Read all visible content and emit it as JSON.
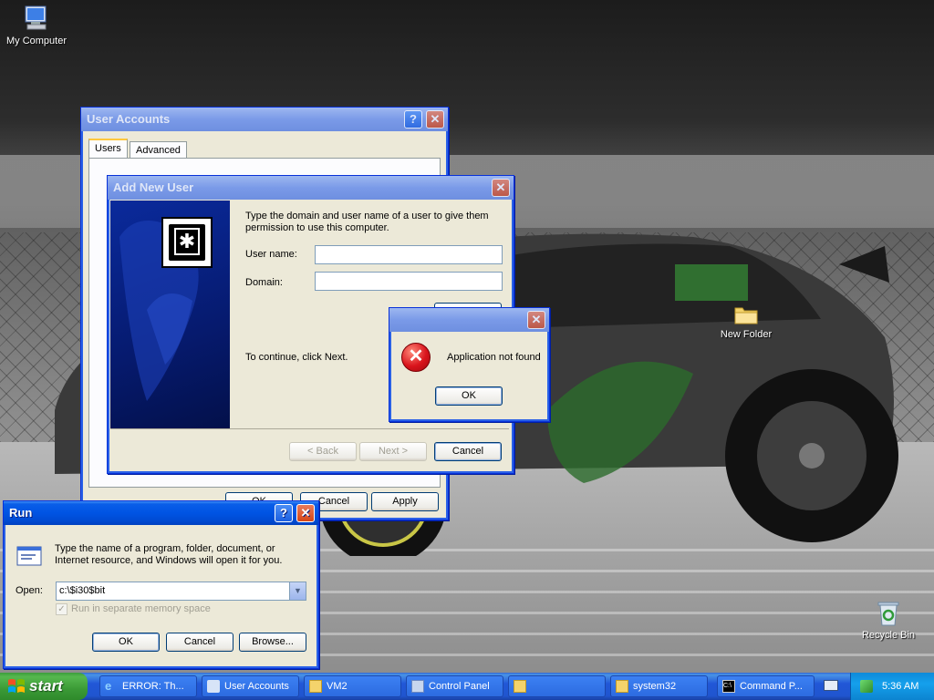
{
  "desktop": {
    "icons": [
      {
        "label": "My Computer",
        "icon": "computer-icon"
      },
      {
        "label": "New Folder",
        "icon": "folder-icon"
      },
      {
        "label": "Recycle Bin",
        "icon": "recycle-bin-icon"
      }
    ]
  },
  "user_accounts": {
    "title": "User Accounts",
    "tabs": [
      "Users",
      "Advanced"
    ],
    "buttons": {
      "ok": "OK",
      "cancel": "Cancel",
      "apply": "Apply"
    }
  },
  "add_new_user": {
    "title": "Add New User",
    "instructions": "Type the domain and user name of a user to give them permission to use this computer.",
    "user_name_label": "User name:",
    "domain_label": "Domain:",
    "user_name_value": "",
    "domain_value": "",
    "continue_text": "To continue, click Next.",
    "buttons": {
      "back": "< Back",
      "next": "Next >",
      "cancel": "Cancel"
    }
  },
  "error_dialog": {
    "message": "Application not found",
    "ok": "OK"
  },
  "run": {
    "title": "Run",
    "description": "Type the name of a program, folder, document, or Internet resource, and Windows will open it for you.",
    "open_label": "Open:",
    "open_value": "c:\\$i30$bit",
    "checkbox_label": "Run in separate memory space",
    "buttons": {
      "ok": "OK",
      "cancel": "Cancel",
      "browse": "Browse..."
    }
  },
  "taskbar": {
    "start_label": "start",
    "tasks": [
      {
        "label": "ERROR: Th...",
        "icon": "ie-icon"
      },
      {
        "label": "User Accounts",
        "icon": "user-accounts-icon"
      },
      {
        "label": "VM2",
        "icon": "folder-icon"
      },
      {
        "label": "Control Panel",
        "icon": "control-panel-icon"
      },
      {
        "label": "",
        "icon": "folder-icon"
      },
      {
        "label": "system32",
        "icon": "folder-icon"
      },
      {
        "label": "Command P...",
        "icon": "cmd-icon"
      }
    ],
    "clock": "5:36 AM"
  },
  "colors": {
    "titlebar_active": "#0054e3",
    "start_green": "#3b9a36",
    "window_face": "#ece9d8"
  }
}
